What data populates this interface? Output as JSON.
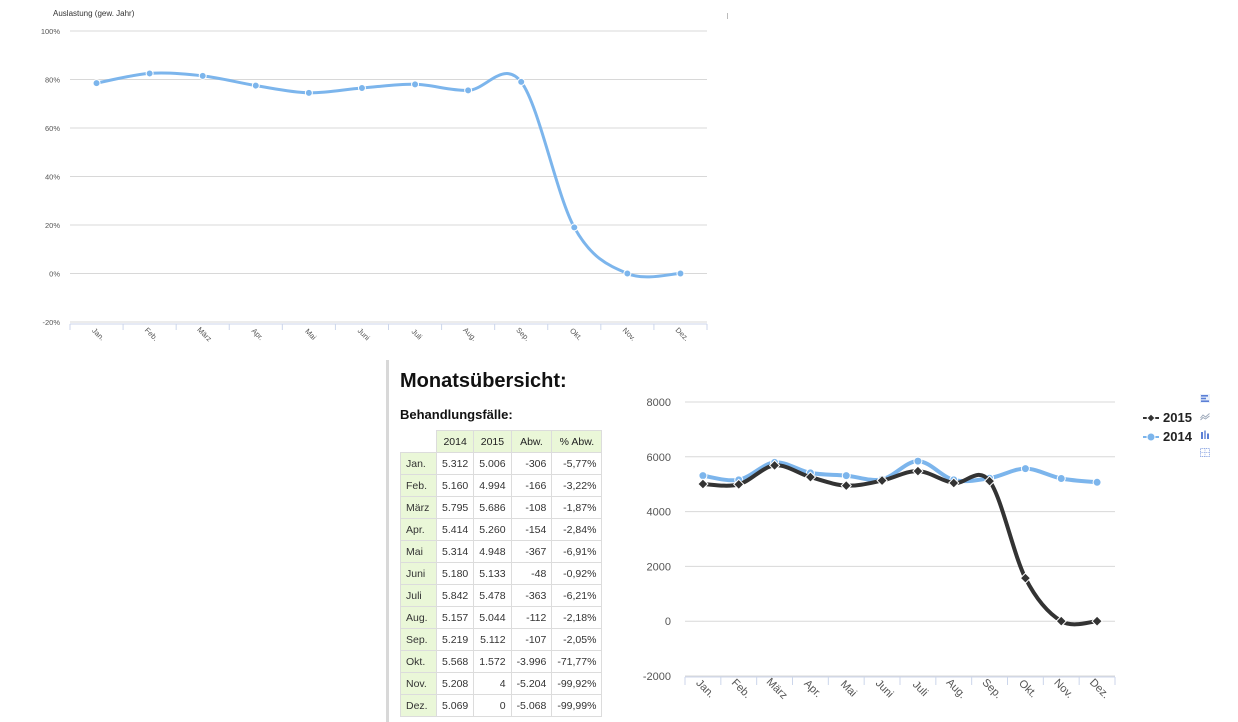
{
  "chart_data": [
    {
      "type": "line",
      "title": "Auslastung (gew. Jahr)",
      "categories": [
        "Jan.",
        "Feb.",
        "März",
        "Apr.",
        "Mai",
        "Juni",
        "Juli",
        "Aug.",
        "Sep.",
        "Okt.",
        "Nov.",
        "Dez."
      ],
      "series": [
        {
          "values": [
            78.5,
            82.5,
            81.5,
            77.5,
            74.5,
            76.5,
            78,
            75.5,
            79,
            19,
            0,
            0
          ],
          "color": "#7cb5ec"
        }
      ],
      "ylim": [
        -20,
        100
      ],
      "yticks": [
        -20,
        0,
        20,
        40,
        60,
        80,
        100
      ],
      "yticklabels": [
        "-20%",
        "0%",
        "20%",
        "40%",
        "60%",
        "80%",
        "100%"
      ],
      "grid": true
    },
    {
      "type": "line",
      "categories": [
        "Jan.",
        "Feb.",
        "März",
        "Apr.",
        "Mai",
        "Juni",
        "Juli",
        "Aug.",
        "Sep.",
        "Okt.",
        "Nov.",
        "Dez."
      ],
      "series": [
        {
          "name": "2015",
          "values": [
            5006,
            4994,
            5686,
            5260,
            4948,
            5133,
            5478,
            5044,
            5112,
            1572,
            4,
            0
          ],
          "color": "#333333"
        },
        {
          "name": "2014",
          "values": [
            5312,
            5160,
            5795,
            5414,
            5314,
            5180,
            5842,
            5157,
            5219,
            5568,
            5208,
            5069
          ],
          "color": "#7cb5ec"
        }
      ],
      "ylim": [
        -2000,
        8000
      ],
      "yticks": [
        -2000,
        0,
        2000,
        4000,
        6000,
        8000
      ],
      "yticklabels": [
        "-2000",
        "0",
        "2000",
        "4000",
        "6000",
        "8000"
      ],
      "grid": true,
      "legend": "right"
    }
  ],
  "overview": {
    "title": "Monatsübersicht:",
    "subtitle": "Behandlungsfälle:",
    "headers": [
      "2014",
      "2015",
      "Abw.",
      "% Abw."
    ],
    "rows": [
      {
        "month": "Jan.",
        "y2014": "5.312",
        "y2015": "5.006",
        "abw": "-306",
        "pct": "-5,77%"
      },
      {
        "month": "Feb.",
        "y2014": "5.160",
        "y2015": "4.994",
        "abw": "-166",
        "pct": "-3,22%"
      },
      {
        "month": "März",
        "y2014": "5.795",
        "y2015": "5.686",
        "abw": "-108",
        "pct": "-1,87%"
      },
      {
        "month": "Apr.",
        "y2014": "5.414",
        "y2015": "5.260",
        "abw": "-154",
        "pct": "-2,84%"
      },
      {
        "month": "Mai",
        "y2014": "5.314",
        "y2015": "4.948",
        "abw": "-367",
        "pct": "-6,91%"
      },
      {
        "month": "Juni",
        "y2014": "5.180",
        "y2015": "5.133",
        "abw": "-48",
        "pct": "-0,92%"
      },
      {
        "month": "Juli",
        "y2014": "5.842",
        "y2015": "5.478",
        "abw": "-363",
        "pct": "-6,21%"
      },
      {
        "month": "Aug.",
        "y2014": "5.157",
        "y2015": "5.044",
        "abw": "-112",
        "pct": "-2,18%"
      },
      {
        "month": "Sep.",
        "y2014": "5.219",
        "y2015": "5.112",
        "abw": "-107",
        "pct": "-2,05%"
      },
      {
        "month": "Okt.",
        "y2014": "5.568",
        "y2015": "1.572",
        "abw": "-3.996",
        "pct": "-71,77%"
      },
      {
        "month": "Nov.",
        "y2014": "5.208",
        "y2015": "4",
        "abw": "-5.204",
        "pct": "-99,92%"
      },
      {
        "month": "Dez.",
        "y2014": "5.069",
        "y2015": "0",
        "abw": "-5.068",
        "pct": "-99,99%"
      }
    ]
  },
  "toolbar_icons": [
    "bar-chart-icon",
    "line-chart-icon",
    "column-chart-icon",
    "table-icon"
  ]
}
